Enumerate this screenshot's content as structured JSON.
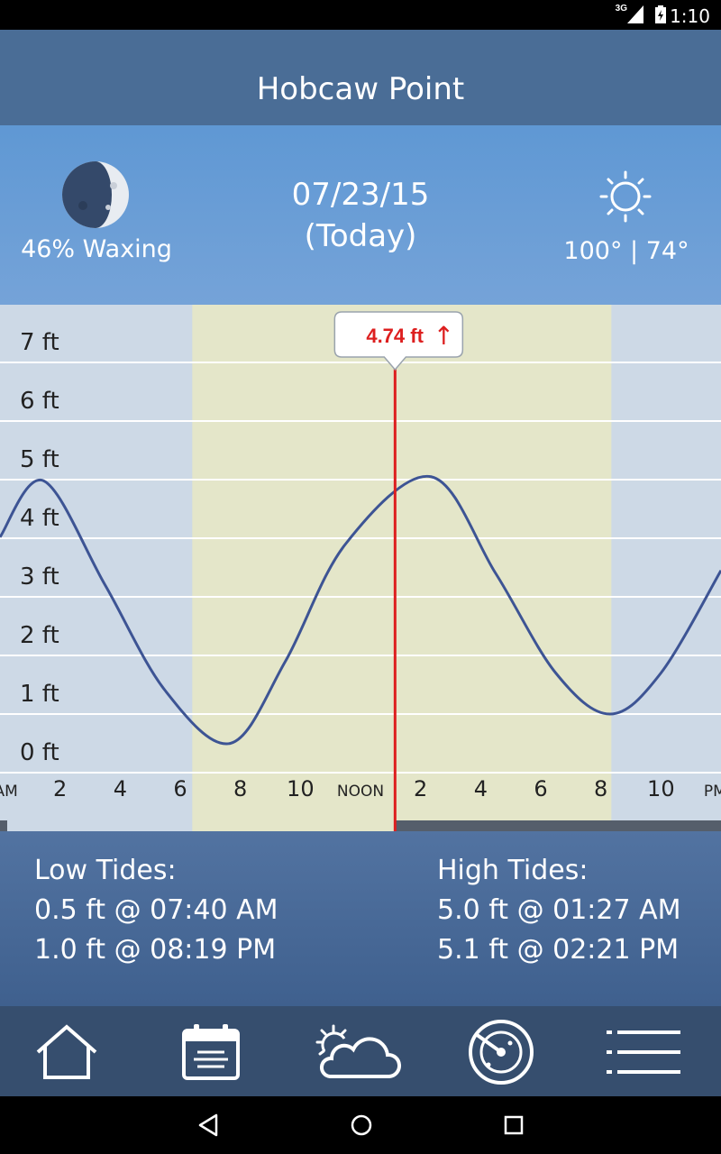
{
  "status_bar": {
    "network": "3G",
    "time": "1:10"
  },
  "header": {
    "title": "Hobcaw Point"
  },
  "info": {
    "moon_label": "46% Waxing",
    "date": "07/23/15",
    "date_note": "(Today)",
    "temps": "100° | 74°",
    "icons": {
      "moon": "moon-phase-icon",
      "weather": "sun-icon"
    }
  },
  "current_tide": {
    "value": "4.74 ft",
    "trend_icon": "↑",
    "trend": "rising"
  },
  "chart_data": {
    "type": "line",
    "xlabel": "",
    "ylabel": "",
    "y_tick_labels": [
      "0 ft",
      "1 ft",
      "2 ft",
      "3 ft",
      "4 ft",
      "5 ft",
      "6 ft",
      "7 ft"
    ],
    "ylim": [
      0,
      7.5
    ],
    "xlim": [
      0,
      24
    ],
    "x_tick_labels": [
      {
        "label": "AM",
        "x": 0.2,
        "small": true
      },
      {
        "label": "2",
        "x": 2
      },
      {
        "label": "4",
        "x": 4
      },
      {
        "label": "6",
        "x": 6
      },
      {
        "label": "8",
        "x": 8
      },
      {
        "label": "10",
        "x": 10
      },
      {
        "label": "NOON",
        "x": 12,
        "small": true
      },
      {
        "label": "2",
        "x": 14
      },
      {
        "label": "4",
        "x": 16
      },
      {
        "label": "6",
        "x": 18
      },
      {
        "label": "8",
        "x": 20
      },
      {
        "label": "10",
        "x": 22
      },
      {
        "label": "PM",
        "x": 23.8,
        "small": true
      }
    ],
    "daylight": {
      "start_hour": 6.4,
      "end_hour": 20.35
    },
    "current_hour": 13.15,
    "series": [
      {
        "color": "#3d5494",
        "points": [
          [
            0.0,
            4.02
          ],
          [
            1.45,
            4.98
          ],
          [
            3.5,
            3.2
          ],
          [
            5.5,
            1.4
          ],
          [
            7.67,
            0.5
          ],
          [
            9.5,
            1.9
          ],
          [
            11.5,
            3.9
          ],
          [
            14.35,
            5.05
          ],
          [
            16.5,
            3.4
          ],
          [
            18.5,
            1.7
          ],
          [
            20.3,
            1.0
          ],
          [
            22.0,
            1.7
          ],
          [
            24.0,
            3.45
          ]
        ]
      }
    ],
    "colors": {
      "night": "#cdd9e6",
      "day": "#e4e6c9",
      "grid": "#ffffff",
      "marker": "#dd1f1f",
      "line": "#3d5494"
    }
  },
  "tides": {
    "low_title": "Low Tides:",
    "low": [
      "0.5 ft @ 07:40 AM",
      "1.0 ft @ 08:19 PM"
    ],
    "high_title": "High Tides:",
    "high": [
      "5.0 ft @ 01:27 AM",
      "5.1 ft @ 02:21 PM"
    ]
  },
  "nav": {
    "items": [
      {
        "name": "home-icon"
      },
      {
        "name": "calendar-icon"
      },
      {
        "name": "weather-icon"
      },
      {
        "name": "radar-icon"
      },
      {
        "name": "menu-icon"
      }
    ]
  },
  "system_nav": {
    "back": "back-icon",
    "home": "home-circle-icon",
    "recents": "recents-icon"
  }
}
